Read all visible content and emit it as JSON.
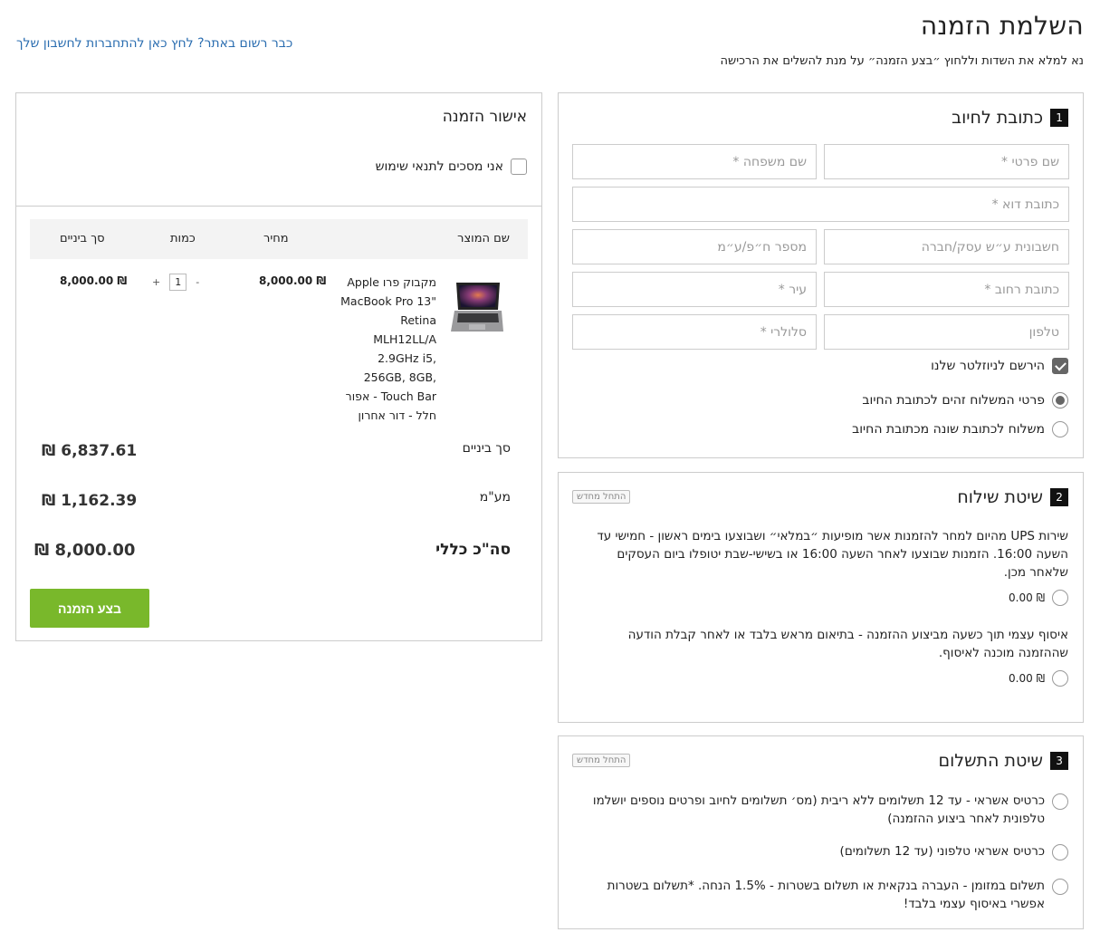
{
  "page": {
    "title": "השלמת הזמנה",
    "subtitle": "נא למלא את השדות וללחוץ ״בצע הזמנה״ על מנת להשלים את הרכישה",
    "login_link": "כבר רשום באתר? לחץ כאן להתחברות לחשבון שלך"
  },
  "billing": {
    "step": "1",
    "title": "כתובת לחיוב",
    "fields": {
      "first_name": "שם פרטי *",
      "last_name": "שם משפחה *",
      "email": "כתובת דוא *",
      "company_invoice": "חשבונית ע״ש עסק/חברה",
      "company_id": "מספר ח״פ/ע״מ",
      "street": "כתובת רחוב *",
      "city": "עיר *",
      "phone": "טלפון",
      "mobile": "סלולרי *"
    },
    "newsletter_label": "הירשם לניוזלטר שלנו",
    "newsletter_checked": true,
    "ship_same_label": "פרטי המשלוח זהים לכתובת החיוב",
    "ship_different_label": "משלוח לכתובת שונה מכתובת החיוב"
  },
  "shipping": {
    "step": "2",
    "title": "שיטת שילוח",
    "restart": "התחל מחדש",
    "option1_text": "שירות UPS מהיום למחר להזמנות אשר מופיעות ״במלאי״ ושבוצעו בימים ראשון - חמישי עד השעה 16:00. הזמנות שבוצעו לאחר השעה 16:00 או בשישי-שבת יטופלו ביום העסקים שלאחר מכן.",
    "option1_price": "₪ 0.00",
    "option2_text": "איסוף עצמי תוך כשעה מביצוע ההזמנה - בתיאום מראש בלבד או לאחר קבלת הודעה שההזמנה מוכנה לאיסוף.",
    "option2_price": "₪ 0.00"
  },
  "payment": {
    "step": "3",
    "title": "שיטת התשלום",
    "restart": "התחל מחדש",
    "options": [
      "כרטיס אשראי - עד 12 תשלומים ללא ריבית (מס׳ תשלומים לחיוב ופרטים נוספים יושלמו טלפונית לאחר ביצוע ההזמנה)",
      "כרטיס אשראי טלפוני (עד 12 תשלומים)",
      "תשלום במזומן - העברה בנקאית או תשלום בשטרות - 1.5% הנחה. *תשלום בשטרות אפשרי באיסוף עצמי בלבד!"
    ]
  },
  "order": {
    "title": "אישור הזמנה",
    "terms_label": "אני מסכים לתנאי שימוש",
    "columns": {
      "product": "שם המוצר",
      "price": "מחיר",
      "qty": "כמות",
      "subtotal": "סך ביניים"
    },
    "item": {
      "name": "מקבוק פרו Apple MacBook Pro 13\" Retina MLH12LL/A 2.9GHz i5, 256GB, 8GB, Touch Bar - אפור חלל - דור אחרון",
      "price": "₪ 8,000.00",
      "qty": "1",
      "minus": "-",
      "plus": "+",
      "subtotal": "₪ 8,000.00"
    },
    "summary": {
      "subtotal_label": "סך ביניים",
      "subtotal_value": "₪ 6,837.61",
      "vat_label": "מע\"מ",
      "vat_value": "₪ 1,162.39",
      "total_label": "סה\"כ כללי",
      "total_value": "₪ 8,000.00"
    },
    "submit": "בצע הזמנה"
  },
  "colors": {
    "accent_green": "#79b82b",
    "link_blue": "#2a6db0"
  }
}
